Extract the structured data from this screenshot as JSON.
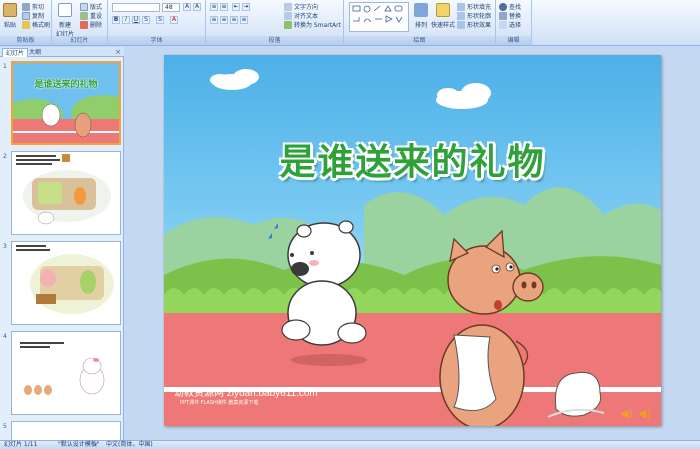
{
  "ribbon": {
    "clipboard": {
      "label": "剪贴板",
      "paste": "粘贴",
      "cut": "剪切",
      "copy": "复制",
      "format_painter": "格式刷"
    },
    "slides": {
      "label": "幻灯片",
      "new_slide": "新建\n幻灯片",
      "layout": "版式",
      "reset": "重设",
      "delete": "删除"
    },
    "font": {
      "label": "字体",
      "size": "48"
    },
    "paragraph": {
      "label": "段落",
      "text_direction": "文字方向",
      "align_text": "对齐文本",
      "smartart": "转换为 SmartArt"
    },
    "drawing": {
      "label": "绘图",
      "arrange": "排列",
      "quick_styles": "快速样式",
      "shape_fill": "形状填充",
      "shape_outline": "形状轮廓",
      "shape_effects": "形状效果"
    },
    "editing": {
      "label": "编辑",
      "find": "查找",
      "replace": "替换",
      "select": "选择"
    }
  },
  "panel": {
    "tab_slides": "幻灯片",
    "tab_outline": "大纲",
    "thumbnails": [
      {
        "number": "1",
        "title": "是谁送来的礼物"
      },
      {
        "number": "2"
      },
      {
        "number": "3"
      },
      {
        "number": "4"
      },
      {
        "number": "5"
      }
    ]
  },
  "slide": {
    "title": "是谁送来的礼物",
    "watermark": "幼教资源网 ziyuan.baby611.com",
    "watermark_sub": "PPT课件  FLASH课件  教案资源下载"
  },
  "status": {
    "slide_counter": "幻灯片 1/11",
    "theme": "\"默认设计模板\"",
    "language": "中文(简体，中国)"
  },
  "colors": {
    "title_green": "#2fa13a",
    "sky": "#4cb0e8",
    "track": "#ee7777",
    "grass": "#7cc24a"
  }
}
